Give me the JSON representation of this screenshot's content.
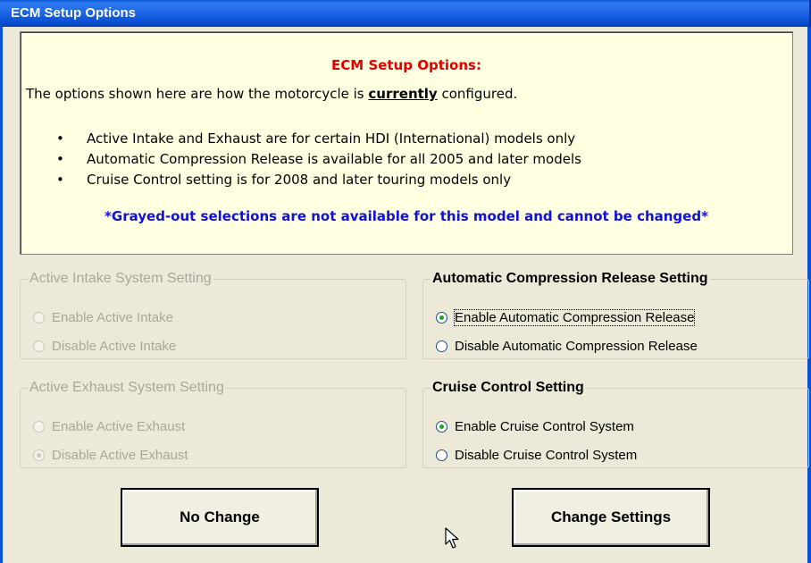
{
  "window": {
    "title": "ECM Setup Options"
  },
  "info": {
    "heading": "ECM Setup Options:",
    "intro_before": "The options shown here are how the motorcycle is ",
    "intro_emph": "currently",
    "intro_after": " configured.",
    "bullets": [
      "Active Intake and Exhaust are for certain HDI (International) models only",
      "Automatic Compression Release is available for all 2005 and later models",
      "Cruise Control setting is for 2008 and later touring models only"
    ],
    "note": "*Grayed-out selections are not available for this model and cannot be changed*"
  },
  "intake": {
    "legend": "Active Intake System Setting",
    "options": [
      "Enable Active Intake",
      "Disable Active Intake"
    ],
    "selected": null,
    "enabled": false
  },
  "exhaust": {
    "legend": "Active Exhaust System Setting",
    "options": [
      "Enable Active Exhaust",
      "Disable Active Exhaust"
    ],
    "selected": 1,
    "enabled": false
  },
  "compression": {
    "legend": "Automatic Compression Release Setting",
    "options": [
      "Enable Automatic Compression Release",
      "Disable Automatic Compression Release"
    ],
    "selected": 0,
    "enabled": true
  },
  "cruise": {
    "legend": "Cruise Control Setting",
    "options": [
      "Enable Cruise Control System",
      "Disable Cruise Control System"
    ],
    "selected": 0,
    "enabled": true
  },
  "buttons": {
    "no_change": "No Change",
    "change_settings": "Change Settings"
  }
}
